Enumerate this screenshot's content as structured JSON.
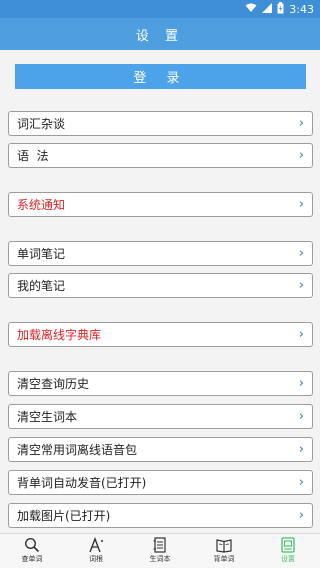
{
  "status": {
    "time": "3:43"
  },
  "header": {
    "title": "设 置"
  },
  "login": {
    "label": "登 录"
  },
  "menu": [
    {
      "label": "词汇杂谈",
      "chevron": "›"
    },
    {
      "label": "语  法",
      "chevron": "›"
    },
    {
      "label": "系统通知",
      "chevron": "›",
      "color": "#d8262a"
    },
    {
      "label": "单词笔记",
      "chevron": "›"
    },
    {
      "label": "我的笔记",
      "chevron": "›"
    },
    {
      "label": "加载离线字典库",
      "chevron": "›",
      "color": "#d8262a"
    },
    {
      "label": "清空查询历史",
      "chevron": "›"
    },
    {
      "label": "清空生词本",
      "chevron": "›"
    },
    {
      "label": "清空常用词离线语音包",
      "chevron": "›"
    },
    {
      "label": "背单词自动发音(已打开)",
      "chevron": "›"
    },
    {
      "label": "加载图片(已打开)",
      "chevron": "›"
    }
  ],
  "tabs": [
    {
      "label": "查单词",
      "icon": "search-icon"
    },
    {
      "label": "词根",
      "icon": "font-icon"
    },
    {
      "label": "生词本",
      "icon": "notebook-icon"
    },
    {
      "label": "背单词",
      "icon": "book-icon"
    },
    {
      "label": "设置",
      "icon": "settings-icon",
      "active": true
    }
  ],
  "colors": {
    "accent": "#4f9fe0",
    "active_tab": "#43c06b",
    "warning": "#d8262a"
  }
}
